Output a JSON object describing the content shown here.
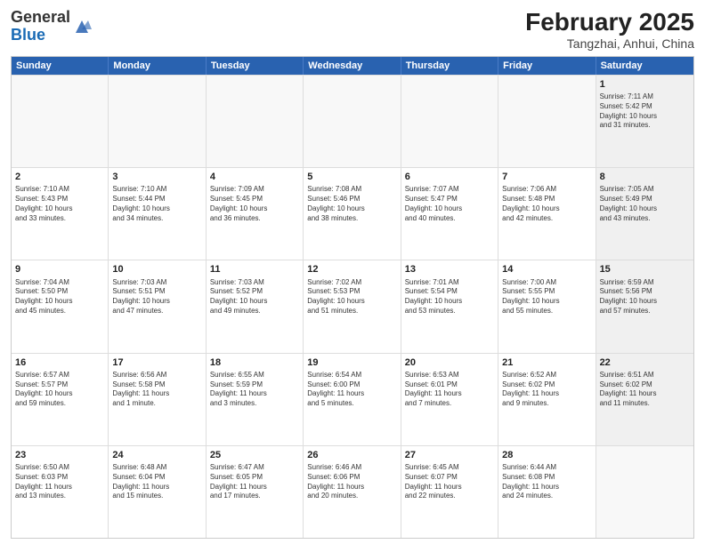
{
  "logo": {
    "general": "General",
    "blue": "Blue"
  },
  "header": {
    "title": "February 2025",
    "subtitle": "Tangzhai, Anhui, China"
  },
  "days": [
    "Sunday",
    "Monday",
    "Tuesday",
    "Wednesday",
    "Thursday",
    "Friday",
    "Saturday"
  ],
  "weeks": [
    [
      {
        "day": "",
        "info": "",
        "empty": true
      },
      {
        "day": "",
        "info": "",
        "empty": true
      },
      {
        "day": "",
        "info": "",
        "empty": true
      },
      {
        "day": "",
        "info": "",
        "empty": true
      },
      {
        "day": "",
        "info": "",
        "empty": true
      },
      {
        "day": "",
        "info": "",
        "empty": true
      },
      {
        "day": "1",
        "info": "Sunrise: 7:11 AM\nSunset: 5:42 PM\nDaylight: 10 hours\nand 31 minutes.",
        "empty": false,
        "shaded": true
      }
    ],
    [
      {
        "day": "2",
        "info": "Sunrise: 7:10 AM\nSunset: 5:43 PM\nDaylight: 10 hours\nand 33 minutes.",
        "empty": false,
        "shaded": false
      },
      {
        "day": "3",
        "info": "Sunrise: 7:10 AM\nSunset: 5:44 PM\nDaylight: 10 hours\nand 34 minutes.",
        "empty": false,
        "shaded": false
      },
      {
        "day": "4",
        "info": "Sunrise: 7:09 AM\nSunset: 5:45 PM\nDaylight: 10 hours\nand 36 minutes.",
        "empty": false,
        "shaded": false
      },
      {
        "day": "5",
        "info": "Sunrise: 7:08 AM\nSunset: 5:46 PM\nDaylight: 10 hours\nand 38 minutes.",
        "empty": false,
        "shaded": false
      },
      {
        "day": "6",
        "info": "Sunrise: 7:07 AM\nSunset: 5:47 PM\nDaylight: 10 hours\nand 40 minutes.",
        "empty": false,
        "shaded": false
      },
      {
        "day": "7",
        "info": "Sunrise: 7:06 AM\nSunset: 5:48 PM\nDaylight: 10 hours\nand 42 minutes.",
        "empty": false,
        "shaded": false
      },
      {
        "day": "8",
        "info": "Sunrise: 7:05 AM\nSunset: 5:49 PM\nDaylight: 10 hours\nand 43 minutes.",
        "empty": false,
        "shaded": true
      }
    ],
    [
      {
        "day": "9",
        "info": "Sunrise: 7:04 AM\nSunset: 5:50 PM\nDaylight: 10 hours\nand 45 minutes.",
        "empty": false,
        "shaded": false
      },
      {
        "day": "10",
        "info": "Sunrise: 7:03 AM\nSunset: 5:51 PM\nDaylight: 10 hours\nand 47 minutes.",
        "empty": false,
        "shaded": false
      },
      {
        "day": "11",
        "info": "Sunrise: 7:03 AM\nSunset: 5:52 PM\nDaylight: 10 hours\nand 49 minutes.",
        "empty": false,
        "shaded": false
      },
      {
        "day": "12",
        "info": "Sunrise: 7:02 AM\nSunset: 5:53 PM\nDaylight: 10 hours\nand 51 minutes.",
        "empty": false,
        "shaded": false
      },
      {
        "day": "13",
        "info": "Sunrise: 7:01 AM\nSunset: 5:54 PM\nDaylight: 10 hours\nand 53 minutes.",
        "empty": false,
        "shaded": false
      },
      {
        "day": "14",
        "info": "Sunrise: 7:00 AM\nSunset: 5:55 PM\nDaylight: 10 hours\nand 55 minutes.",
        "empty": false,
        "shaded": false
      },
      {
        "day": "15",
        "info": "Sunrise: 6:59 AM\nSunset: 5:56 PM\nDaylight: 10 hours\nand 57 minutes.",
        "empty": false,
        "shaded": true
      }
    ],
    [
      {
        "day": "16",
        "info": "Sunrise: 6:57 AM\nSunset: 5:57 PM\nDaylight: 10 hours\nand 59 minutes.",
        "empty": false,
        "shaded": false
      },
      {
        "day": "17",
        "info": "Sunrise: 6:56 AM\nSunset: 5:58 PM\nDaylight: 11 hours\nand 1 minute.",
        "empty": false,
        "shaded": false
      },
      {
        "day": "18",
        "info": "Sunrise: 6:55 AM\nSunset: 5:59 PM\nDaylight: 11 hours\nand 3 minutes.",
        "empty": false,
        "shaded": false
      },
      {
        "day": "19",
        "info": "Sunrise: 6:54 AM\nSunset: 6:00 PM\nDaylight: 11 hours\nand 5 minutes.",
        "empty": false,
        "shaded": false
      },
      {
        "day": "20",
        "info": "Sunrise: 6:53 AM\nSunset: 6:01 PM\nDaylight: 11 hours\nand 7 minutes.",
        "empty": false,
        "shaded": false
      },
      {
        "day": "21",
        "info": "Sunrise: 6:52 AM\nSunset: 6:02 PM\nDaylight: 11 hours\nand 9 minutes.",
        "empty": false,
        "shaded": false
      },
      {
        "day": "22",
        "info": "Sunrise: 6:51 AM\nSunset: 6:02 PM\nDaylight: 11 hours\nand 11 minutes.",
        "empty": false,
        "shaded": true
      }
    ],
    [
      {
        "day": "23",
        "info": "Sunrise: 6:50 AM\nSunset: 6:03 PM\nDaylight: 11 hours\nand 13 minutes.",
        "empty": false,
        "shaded": false
      },
      {
        "day": "24",
        "info": "Sunrise: 6:48 AM\nSunset: 6:04 PM\nDaylight: 11 hours\nand 15 minutes.",
        "empty": false,
        "shaded": false
      },
      {
        "day": "25",
        "info": "Sunrise: 6:47 AM\nSunset: 6:05 PM\nDaylight: 11 hours\nand 17 minutes.",
        "empty": false,
        "shaded": false
      },
      {
        "day": "26",
        "info": "Sunrise: 6:46 AM\nSunset: 6:06 PM\nDaylight: 11 hours\nand 20 minutes.",
        "empty": false,
        "shaded": false
      },
      {
        "day": "27",
        "info": "Sunrise: 6:45 AM\nSunset: 6:07 PM\nDaylight: 11 hours\nand 22 minutes.",
        "empty": false,
        "shaded": false
      },
      {
        "day": "28",
        "info": "Sunrise: 6:44 AM\nSunset: 6:08 PM\nDaylight: 11 hours\nand 24 minutes.",
        "empty": false,
        "shaded": false
      },
      {
        "day": "",
        "info": "",
        "empty": true
      }
    ]
  ]
}
